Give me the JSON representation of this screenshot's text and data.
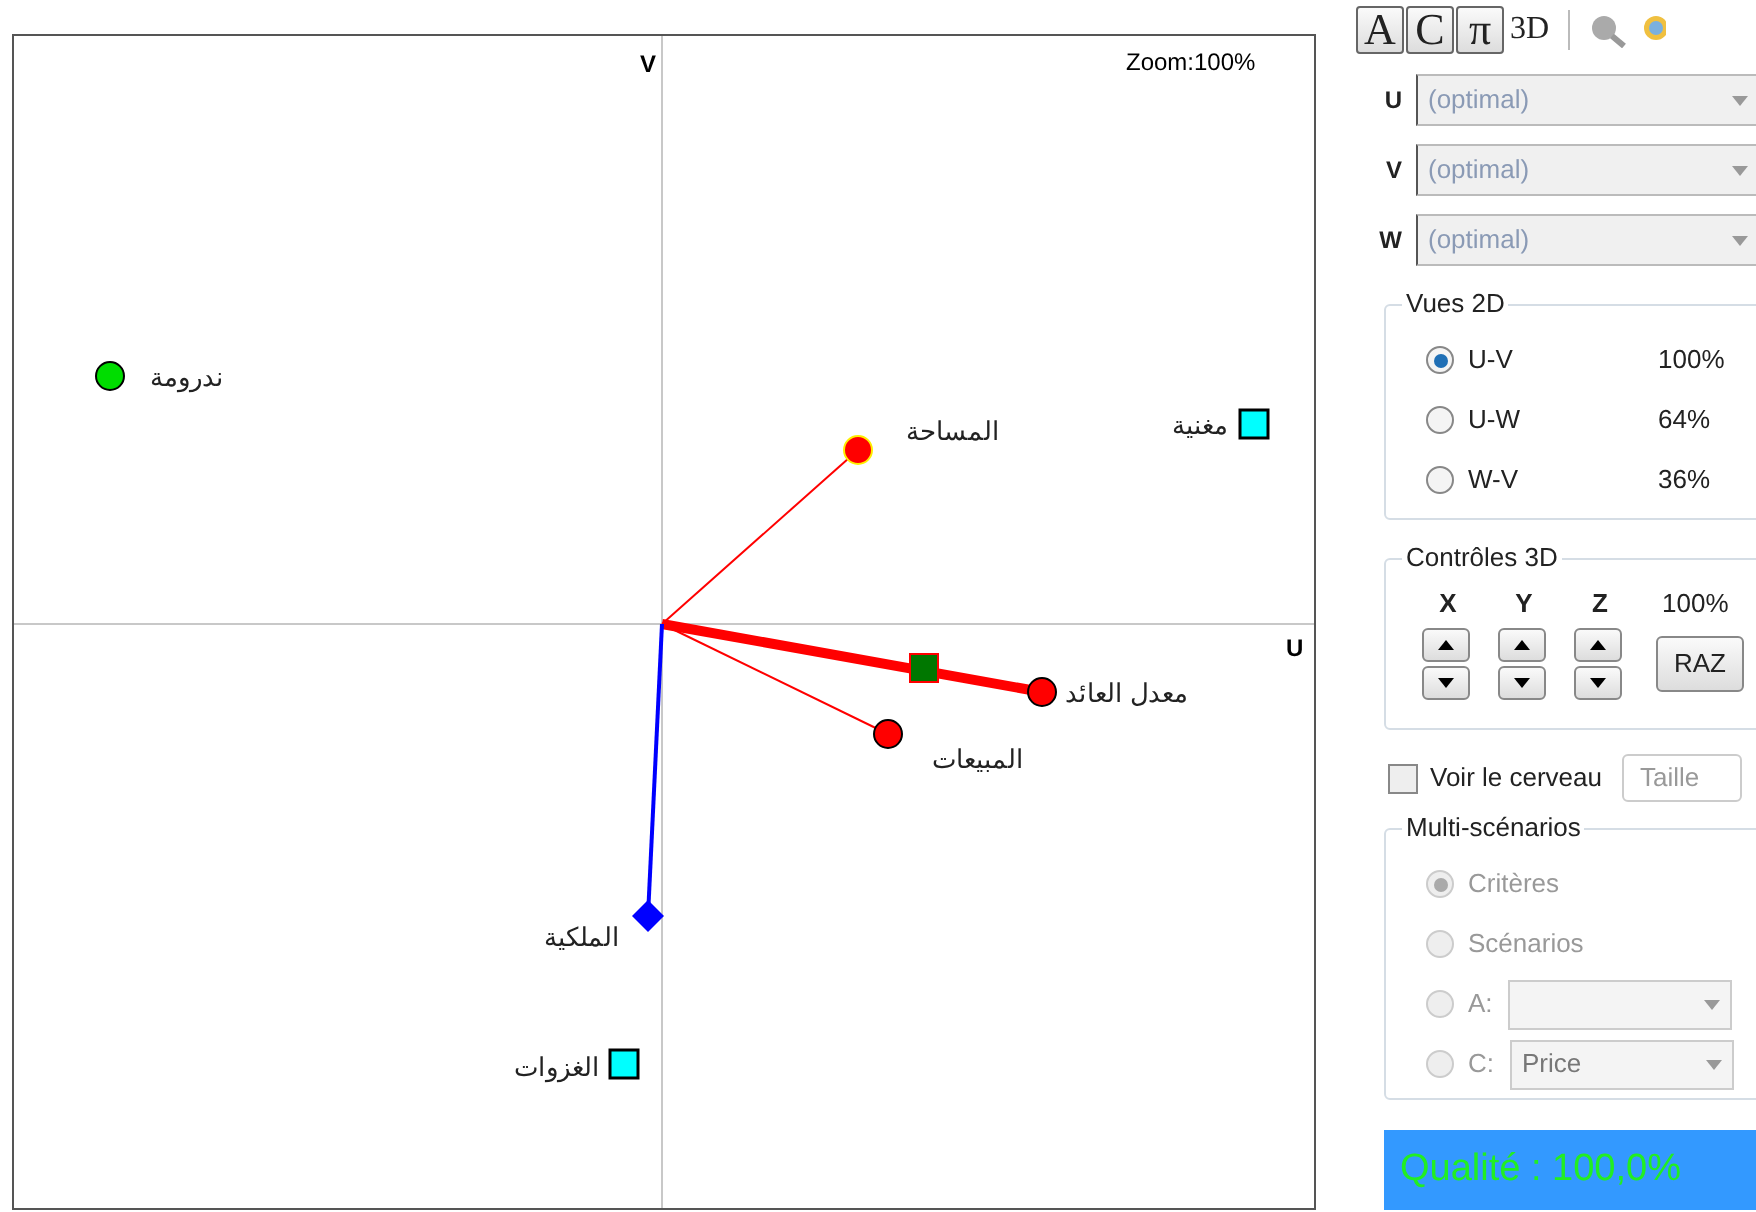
{
  "plot": {
    "zoom": "Zoom:100%",
    "axis_v": "V",
    "axis_u": "U",
    "points": [
      {
        "label": "ندرومة",
        "kind": "circle",
        "color": "#00dd00"
      },
      {
        "label": "المساحة",
        "kind": "circle",
        "color": "#ff0000",
        "vector": {
          "kind": "thin"
        }
      },
      {
        "label": "مغنية",
        "kind": "square",
        "color": "#00ffff"
      },
      {
        "label": "معدل العائد",
        "kind": "circle",
        "color": "#ff0000",
        "vector": {
          "kind": "thick"
        }
      },
      {
        "label": "المبيعات",
        "kind": "circle",
        "color": "#ff0000",
        "vector": {
          "kind": "thin"
        }
      },
      {
        "label": "الملكية",
        "kind": "diamond",
        "color": "#0000ff",
        "vector": {
          "kind": "blue"
        }
      },
      {
        "label": "الغزوات",
        "kind": "square",
        "color": "#00ffff"
      }
    ]
  },
  "toolbar": {
    "buttons": [
      "A",
      "C",
      "π"
    ],
    "mode": "3D"
  },
  "axes": [
    {
      "label": "U",
      "value": "(optimal)"
    },
    {
      "label": "V",
      "value": "(optimal)"
    },
    {
      "label": "W",
      "value": "(optimal)"
    }
  ],
  "views_2d": {
    "title": "Vues 2D",
    "items": [
      {
        "label": "U-V",
        "value": "100%",
        "selected": true
      },
      {
        "label": "U-W",
        "value": "64%",
        "selected": false
      },
      {
        "label": "W-V",
        "value": "36%",
        "selected": false
      }
    ]
  },
  "controls_3d": {
    "title": "Contrôles 3D",
    "axes": [
      "X",
      "Y",
      "Z"
    ],
    "value": "100%",
    "reset": "RAZ"
  },
  "brain": {
    "label": "Voir le cerveau",
    "checked": false,
    "size_button": "Taille"
  },
  "multi": {
    "title": "Multi-scénarios",
    "disabled": true,
    "items": [
      {
        "label": "Critères",
        "kind": "radio",
        "selected": true
      },
      {
        "label": "Scénarios",
        "kind": "radio",
        "selected": false
      },
      {
        "label": "A:",
        "kind": "select",
        "selected": false
      },
      {
        "label": "C:",
        "kind": "select",
        "selected": false,
        "value": "Price"
      }
    ]
  },
  "quality": "Qualité : 100,0%"
}
